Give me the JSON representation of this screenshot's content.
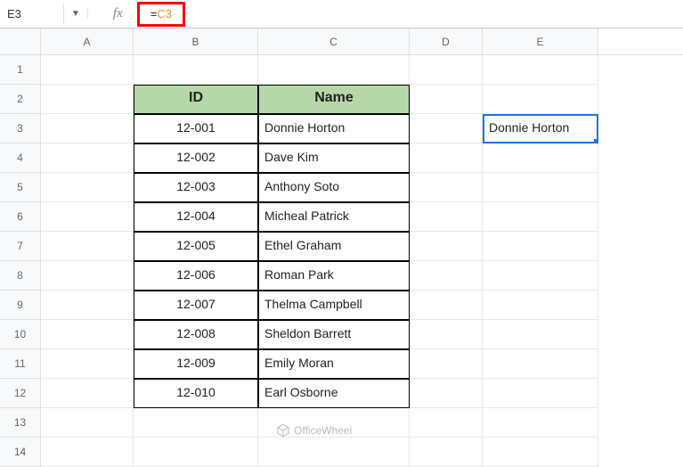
{
  "formula_bar": {
    "cell_ref": "E3",
    "fx": "fx",
    "formula_eq": "=",
    "formula_ref": "C3"
  },
  "columns": [
    "A",
    "B",
    "C",
    "D",
    "E"
  ],
  "rows": [
    "1",
    "2",
    "3",
    "4",
    "5",
    "6",
    "7",
    "8",
    "9",
    "10",
    "11",
    "12",
    "13",
    "14"
  ],
  "headers": {
    "id": "ID",
    "name": "Name"
  },
  "data": [
    {
      "id": "12-001",
      "name": "Donnie Horton"
    },
    {
      "id": "12-002",
      "name": "Dave Kim"
    },
    {
      "id": "12-003",
      "name": "Anthony Soto"
    },
    {
      "id": "12-004",
      "name": "Micheal Patrick"
    },
    {
      "id": "12-005",
      "name": "Ethel Graham"
    },
    {
      "id": "12-006",
      "name": "Roman Park"
    },
    {
      "id": "12-007",
      "name": "Thelma Campbell"
    },
    {
      "id": "12-008",
      "name": "Sheldon Barrett"
    },
    {
      "id": "12-009",
      "name": "Emily Moran"
    },
    {
      "id": "12-010",
      "name": "Earl Osborne"
    }
  ],
  "selected_value": "Donnie Horton",
  "watermark": "OfficeWheel",
  "chart_data": {
    "type": "table",
    "title": "",
    "columns": [
      "ID",
      "Name"
    ],
    "rows": [
      [
        "12-001",
        "Donnie Horton"
      ],
      [
        "12-002",
        "Dave Kim"
      ],
      [
        "12-003",
        "Anthony Soto"
      ],
      [
        "12-004",
        "Micheal Patrick"
      ],
      [
        "12-005",
        "Ethel Graham"
      ],
      [
        "12-006",
        "Roman Park"
      ],
      [
        "12-007",
        "Thelma Campbell"
      ],
      [
        "12-008",
        "Sheldon Barrett"
      ],
      [
        "12-009",
        "Emily Moran"
      ],
      [
        "12-010",
        "Earl Osborne"
      ]
    ]
  }
}
